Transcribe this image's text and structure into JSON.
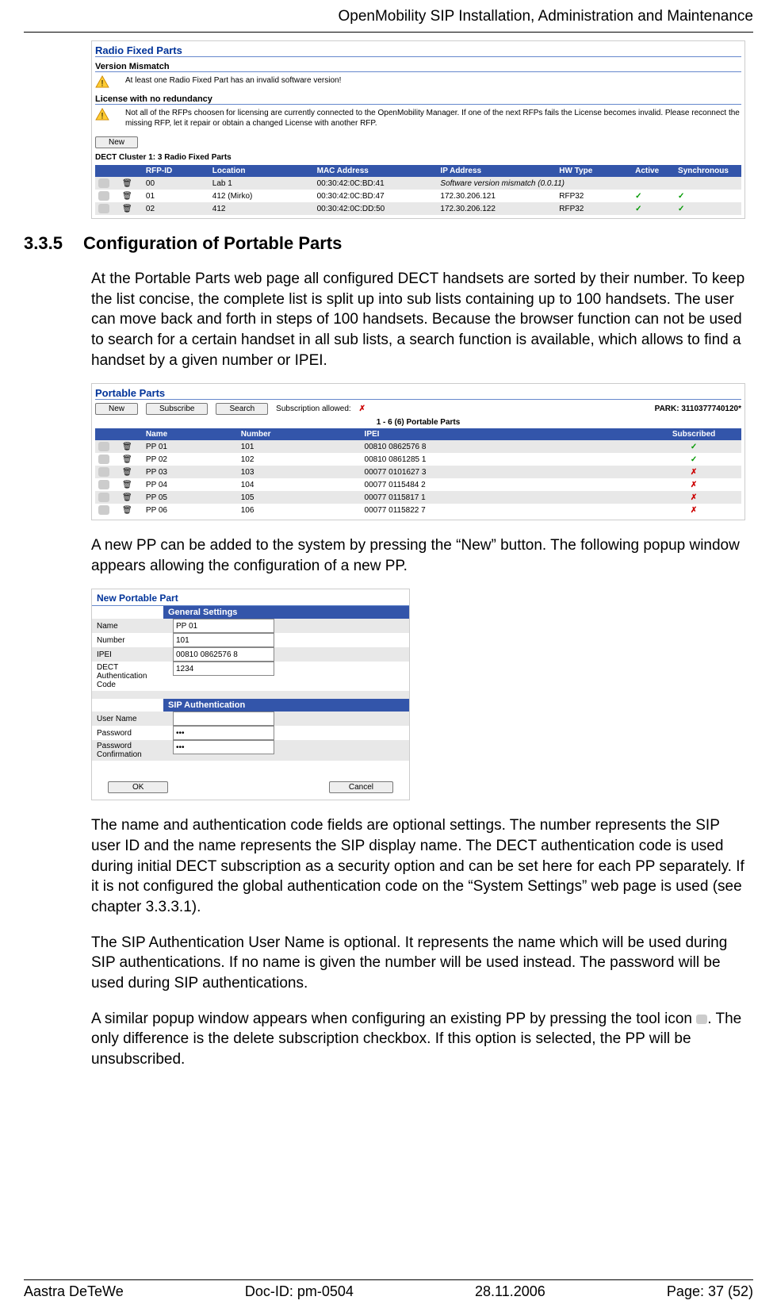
{
  "header": {
    "doc_title": "OpenMobility SIP Installation, Administration and Maintenance"
  },
  "rfp_screenshot": {
    "title": "Radio Fixed Parts",
    "version_mismatch_heading": "Version Mismatch",
    "version_mismatch_text": "At least one Radio Fixed Part has an invalid software version!",
    "license_heading": "License with no redundancy",
    "license_text": "Not all of the RFPs choosen for licensing are currently connected to the OpenMobility Manager. If one of the next RFPs fails the License becomes invalid. Please reconnect the missing RFP, let it repair or obtain a changed License with another RFP.",
    "new_btn": "New",
    "cluster_line": "DECT Cluster 1: 3 Radio Fixed Parts",
    "cols": {
      "rfp_id": "RFP-ID",
      "location": "Location",
      "mac": "MAC Address",
      "ip": "IP Address",
      "hw": "HW Type",
      "active": "Active",
      "sync": "Synchronous"
    },
    "rows": [
      {
        "id": "00",
        "loc": "Lab 1",
        "mac": "00:30:42:0C:BD:41",
        "ip": "Software version mismatch (0.0.11)",
        "ip_italic": true,
        "hw": "",
        "a": "",
        "s": ""
      },
      {
        "id": "01",
        "loc": "412 (Mirko)",
        "mac": "00:30:42:0C:BD:47",
        "ip": "172.30.206.121",
        "hw": "RFP32",
        "a": "✓",
        "s": "✓"
      },
      {
        "id": "02",
        "loc": "412",
        "mac": "00:30:42:0C:DD:50",
        "ip": "172.30.206.122",
        "hw": "RFP32",
        "a": "✓",
        "s": "✓"
      }
    ]
  },
  "section": {
    "num": "3.3.5",
    "title": "Configuration of Portable Parts",
    "p1": "At the Portable Parts web page all configured DECT handsets are sorted by their number. To keep the list concise, the complete list is split up into sub lists containing up to 100 handsets. The user can move back and forth in steps of 100 handsets. Because the browser function can not be used to search for a certain handset in all sub lists, a search function is available, which allows to find a handset by a given number or IPEI.",
    "p2": "A new PP can be added to the system by pressing the “New” button. The following popup window appears allowing the configuration of a new PP.",
    "p3": "The name and authentication code fields are optional settings. The number represents the SIP user ID and the name represents the SIP display name. The DECT authentication code is used during initial DECT subscription as a security option and can be set here for each PP separately. If it is not configured the global authentication code on the “System Settings” web page is used (see chapter 3.3.3.1).",
    "p4": "The SIP Authentication User Name is optional. It represents the name which will be used during SIP authentications. If no name is given the number will be used instead. The password will be used during SIP authentications.",
    "p5a": "A similar popup window appears when configuring an existing PP by pressing the tool icon ",
    "p5b": ". The only difference is the delete subscription checkbox. If this option is selected, the PP will be unsubscribed."
  },
  "pp_screenshot": {
    "title": "Portable Parts",
    "new": "New",
    "subscribe": "Subscribe",
    "search": "Search",
    "sub_allowed_label": "Subscription allowed:",
    "park": "PARK: 3110377740120*",
    "list_header": "1 - 6 (6) Portable Parts",
    "cols": {
      "name": "Name",
      "number": "Number",
      "ipei": "IPEI",
      "subscribed": "Subscribed"
    },
    "rows": [
      {
        "name": "PP 01",
        "num": "101",
        "ipei": "00810 0862576 8",
        "sub": "✓",
        "ok": true
      },
      {
        "name": "PP 02",
        "num": "102",
        "ipei": "00810 0861285 1",
        "sub": "✓",
        "ok": true
      },
      {
        "name": "PP 03",
        "num": "103",
        "ipei": "00077 0101627 3",
        "sub": "✗",
        "ok": false
      },
      {
        "name": "PP 04",
        "num": "104",
        "ipei": "00077 0115484 2",
        "sub": "✗",
        "ok": false
      },
      {
        "name": "PP 05",
        "num": "105",
        "ipei": "00077 0115817 1",
        "sub": "✗",
        "ok": false
      },
      {
        "name": "PP 06",
        "num": "106",
        "ipei": "00077 0115822 7",
        "sub": "✗",
        "ok": false
      }
    ]
  },
  "popup": {
    "title": "New Portable Part",
    "gs_head": "General Settings",
    "name_lbl": "Name",
    "name_val": "PP 01",
    "number_lbl": "Number",
    "number_val": "101",
    "ipei_lbl": "IPEI",
    "ipei_val": "00810 0862576 8",
    "dect_lbl": "DECT Authentication Code",
    "dect_val": "1234",
    "sip_head": "SIP Authentication",
    "user_lbl": "User Name",
    "user_val": "",
    "pass_lbl": "Password",
    "pass_val": "***",
    "passc_lbl": "Password Confirmation",
    "passc_val": "***",
    "ok": "OK",
    "cancel": "Cancel"
  },
  "footer": {
    "company": "Aastra DeTeWe",
    "docid": "Doc-ID: pm-0504",
    "date": "28.11.2006",
    "page": "Page: 37 (52)"
  }
}
